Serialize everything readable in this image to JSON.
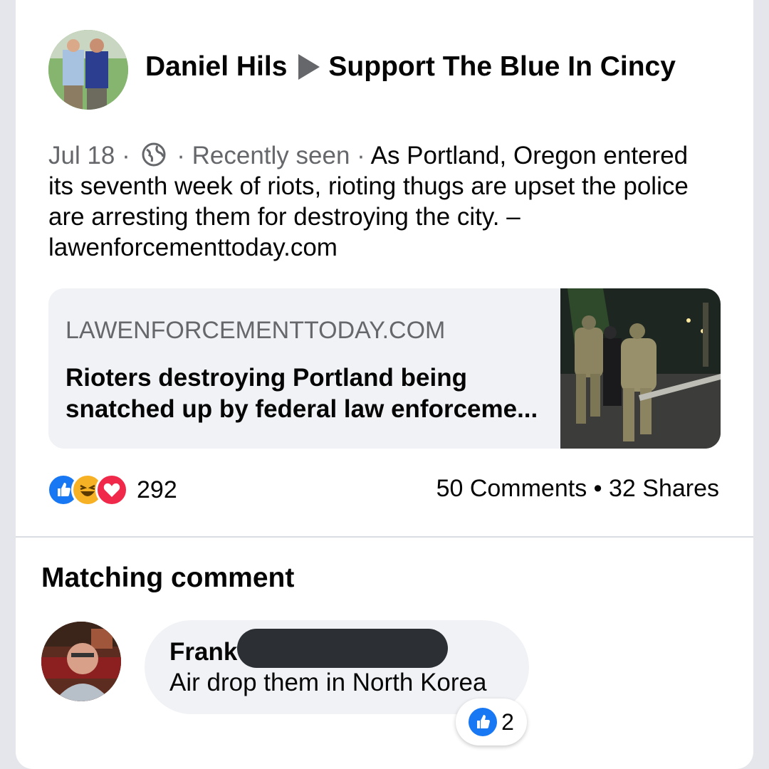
{
  "post": {
    "author": "Daniel Hils",
    "group": "Support The Blue In Cincy",
    "date": "Jul 18",
    "separator1": " · ",
    "seen": " · Recently seen · ",
    "text": "As Portland, Oregon entered its seventh week of riots, rioting thugs are upset the police are arresting them for destroying the city. – lawenforcementtoday.com",
    "privacy_icon": "globe-icon"
  },
  "link_preview": {
    "domain": "LAWENFORCEMENTTODAY.COM",
    "title": "Rioters destroying Portland being snatched up by federal law enforceme..."
  },
  "engagement": {
    "reaction_icons": [
      "like-icon",
      "haha-icon",
      "love-icon"
    ],
    "reaction_count": "292",
    "comments": "50 Comments",
    "dot": " • ",
    "shares": "32 Shares"
  },
  "matching": {
    "title": "Matching comment",
    "commenter": "Frank",
    "comment_text": "Air drop them in North Korea",
    "like_count": "2"
  },
  "colors": {
    "like_blue": "#1877f2",
    "love_red": "#f02849",
    "haha_yellow": "#f7b125",
    "gray_text": "#65676b"
  }
}
